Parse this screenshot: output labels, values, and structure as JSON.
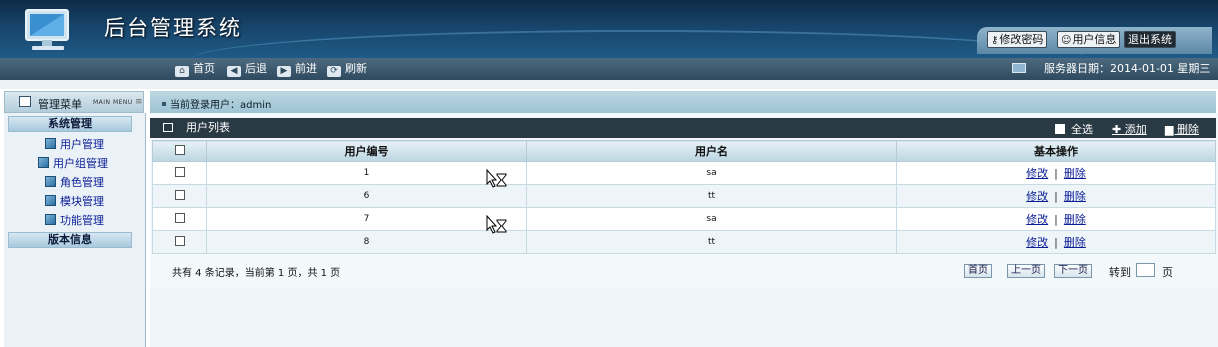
{
  "header": {
    "title": "后台管理系统",
    "buttons": {
      "change_password": "修改密码",
      "user_info": "用户信息",
      "logout": "退出系统"
    }
  },
  "nav": {
    "home": "首页",
    "back": "后退",
    "forward": "前进",
    "refresh": "刷新",
    "server_date": "服务器日期：2014-01-01 星期三"
  },
  "sidebar": {
    "title": "管理菜单",
    "subtitle": "MAIN MENU",
    "groups": [
      {
        "label": "系统管理",
        "items": [
          "用户管理",
          "用户组管理",
          "角色管理",
          "模块管理",
          "功能管理"
        ]
      },
      {
        "label": "版本信息",
        "items": []
      }
    ]
  },
  "main": {
    "current_user": "当前登录用户：admin",
    "list_title": "用户列表",
    "actions": {
      "select_all": "全选",
      "add": "添加",
      "delete": "删除"
    },
    "table": {
      "columns": [
        "用户编号",
        "用户名",
        "基本操作"
      ],
      "rows": [
        {
          "id": "1",
          "name": "sa",
          "edit": "修改",
          "delete": "删除"
        },
        {
          "id": "6",
          "name": "tt",
          "edit": "修改",
          "delete": "删除"
        },
        {
          "id": "7",
          "name": "sa",
          "edit": "修改",
          "delete": "删除"
        },
        {
          "id": "8",
          "name": "tt",
          "edit": "修改",
          "delete": "删除"
        }
      ]
    },
    "pager": {
      "summary": "共有 4 条记录，当前第 1 页，共 1 页",
      "first": "首页",
      "prev": "上一页",
      "next": "下一页",
      "goto": "转到",
      "unit": "页",
      "page_input": ""
    }
  },
  "colors": {
    "header_dark": "#0e2a45",
    "nav_bar": "#2f4a5e",
    "list_bar": "#2a3a45",
    "link": "#0a1c94",
    "table_header": "#bcd6e2"
  }
}
